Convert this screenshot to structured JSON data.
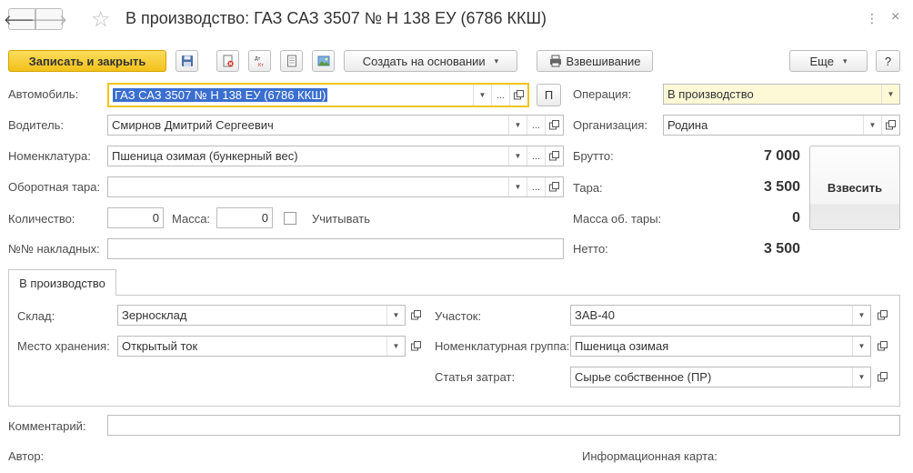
{
  "title": "В производство: ГАЗ САЗ 3507 № Н 138 ЕУ (6786 ККШ)",
  "nav": {
    "back": "🡐",
    "forward": "🡒",
    "favorite": "☆"
  },
  "window": {
    "more": "⋮",
    "close": "×"
  },
  "toolbar": {
    "save_close": "Записать и закрыть",
    "create_based": "Создать на основании",
    "weighing": "Взвешивание",
    "more": "Еще",
    "help": "?"
  },
  "form": {
    "car_label": "Автомобиль:",
    "car_value": "ГАЗ САЗ 3507 № Н 138 ЕУ (6786 ККШ)",
    "p_button": "П",
    "driver_label": "Водитель:",
    "driver_value": "Смирнов Дмитрий Сергеевич",
    "nomen_label": "Номенклатура:",
    "nomen_value": "Пшеница озимая (бункерный вес)",
    "tare_label": "Оборотная тара:",
    "tare_value": "",
    "qty_label": "Количество:",
    "qty_value": "0",
    "mass_label": "Масса:",
    "mass_value": "0",
    "account_label": "Учитывать",
    "invoices_label": "№№ накладных:",
    "invoices_value": "",
    "operation_label": "Операция:",
    "operation_value": "В производство",
    "org_label": "Организация:",
    "org_value": "Родина",
    "gross_label": "Брутто:",
    "gross_value": "7 000",
    "tara_label": "Тара:",
    "tara_value": "3 500",
    "tara_mass_label": "Масса об. тары:",
    "tara_mass_value": "0",
    "net_label": "Нетто:",
    "net_value": "3 500",
    "weigh_button": "Взвесить"
  },
  "tab": {
    "label": "В производство",
    "warehouse_label": "Склад:",
    "warehouse_value": "Зерносклад",
    "storage_label": "Место хранения:",
    "storage_value": "Открытый ток",
    "section_label": "Участок:",
    "section_value": "ЗАВ-40",
    "group_label": "Номенклатурная группа:",
    "group_value": "Пшеница озимая",
    "cost_label": "Статья затрат:",
    "cost_value": "Сырье собственное (ПР)"
  },
  "footer": {
    "comment_label": "Комментарий:",
    "comment_value": "",
    "author_label": "Автор:",
    "info_label": "Информационная карта:"
  },
  "colors": {
    "accent": "#f3c317",
    "selection": "#3b6fcf",
    "highlight_field": "#fdf9d6"
  }
}
